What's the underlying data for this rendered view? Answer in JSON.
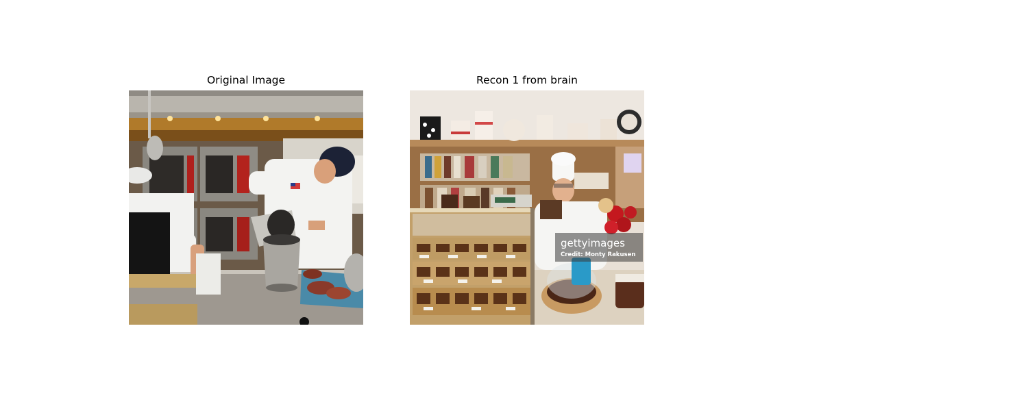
{
  "figure": {
    "panels": [
      {
        "title": "Original Image",
        "scene": "commercial kitchen with two chefs; one pours from a stainless pot into a bucket near ovens"
      },
      {
        "title": "Recon 1 from brain",
        "scene": "bakery shop with chocolate display case, cake shelves and a smiling chef in a white toque"
      }
    ],
    "watermark": {
      "brand": "gettyimages",
      "credit": "Credit: Monty Rakusen"
    }
  }
}
